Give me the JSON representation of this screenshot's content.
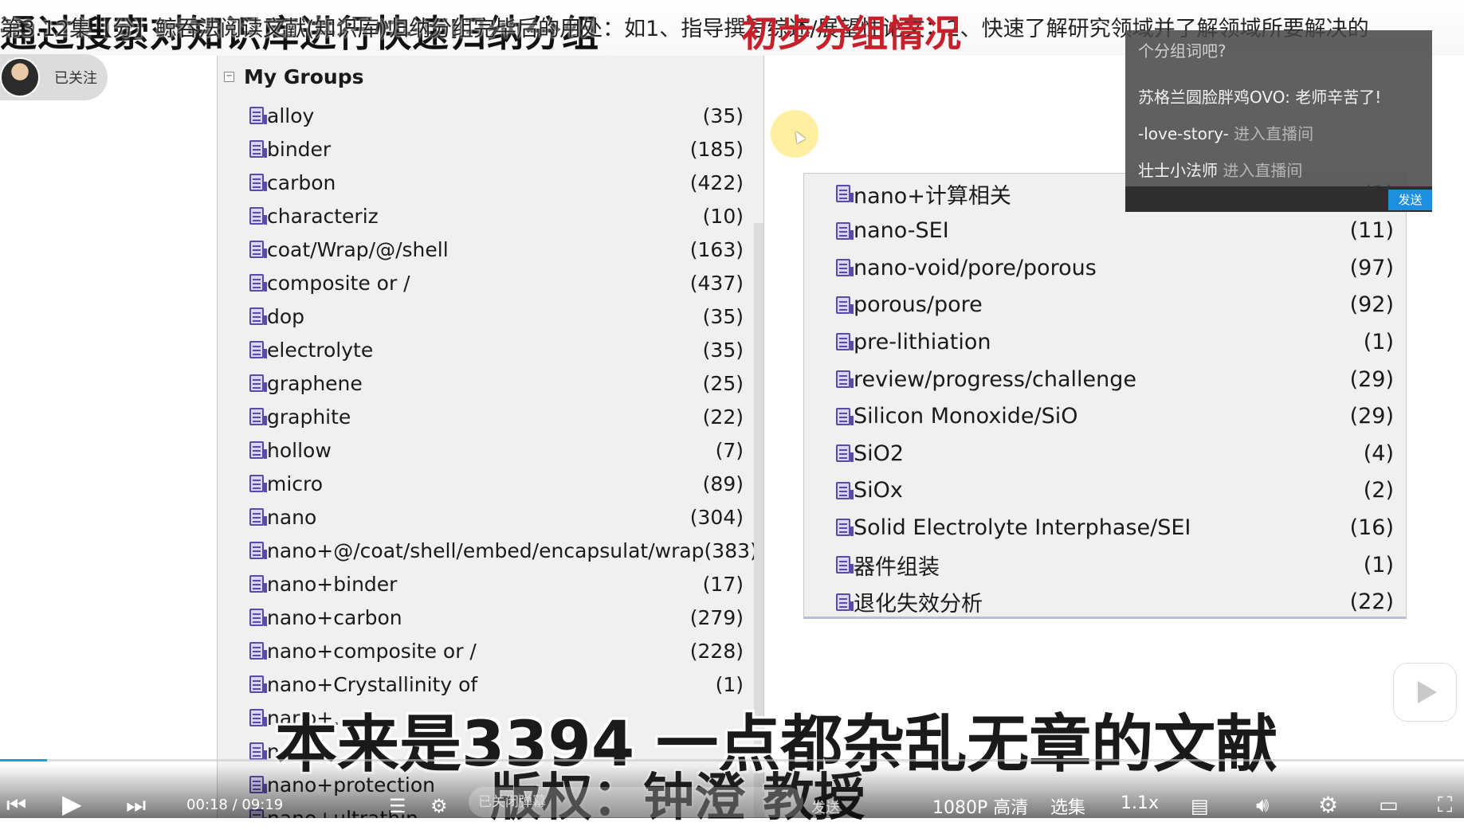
{
  "video": {
    "title_big": "通过搜索对知识库进行快速归纳分组",
    "title_line": "第3.12集【分】鲸吞法阅读文献(知识库)归纳分组完毕后的用处：如1、指导撰写综述/展望性论文；2、快速了解研究领域并了解领域所要解决的",
    "title_red": "初步分组情况",
    "follow_label": "已关注",
    "subtitle": "本来是3394 一点都杂乱无章的文献",
    "copyright": "版权：钟澄 教授"
  },
  "groups": {
    "title": "My Groups",
    "collapse_symbol": "⊟",
    "items": [
      {
        "name": "alloy",
        "count": "(35)"
      },
      {
        "name": "binder",
        "count": "(185)"
      },
      {
        "name": "carbon",
        "count": "(422)"
      },
      {
        "name": "characteriz",
        "count": "(10)"
      },
      {
        "name": "coat/Wrap/@/shell",
        "count": "(163)"
      },
      {
        "name": "composite or /",
        "count": "(437)"
      },
      {
        "name": "dop",
        "count": "(35)"
      },
      {
        "name": "electrolyte",
        "count": "(35)"
      },
      {
        "name": "graphene",
        "count": "(25)"
      },
      {
        "name": "graphite",
        "count": "(22)"
      },
      {
        "name": "hollow",
        "count": "(7)"
      },
      {
        "name": "micro",
        "count": "(89)"
      },
      {
        "name": "nano",
        "count": "(304)"
      },
      {
        "name": "nano+@/coat/shell/embed/encapsulat/wrap",
        "count": "(383)"
      },
      {
        "name": "nano+binder",
        "count": "(17)"
      },
      {
        "name": "nano+carbon",
        "count": "(279)"
      },
      {
        "name": "nano+composite or /",
        "count": "(228)"
      },
      {
        "name": "nano+Crystallinity of",
        "count": "(1)"
      },
      {
        "name": "nano+...",
        "count": ""
      },
      {
        "name": "n...",
        "count": ""
      },
      {
        "name": "nano+protection",
        "count": ""
      },
      {
        "name": "nano+ultrathin",
        "count": ""
      }
    ]
  },
  "subgroups": {
    "items": [
      {
        "name": "nano+计算相关",
        "count": "(1)"
      },
      {
        "name": "nano-SEI",
        "count": "(11)"
      },
      {
        "name": "nano-void/pore/porous",
        "count": "(97)"
      },
      {
        "name": "porous/pore",
        "count": "(92)"
      },
      {
        "name": "pre-lithiation",
        "count": "(1)"
      },
      {
        "name": "review/progress/challenge",
        "count": "(29)"
      },
      {
        "name": "Silicon Monoxide/SiO",
        "count": "(29)"
      },
      {
        "name": "SiO2",
        "count": "(4)"
      },
      {
        "name": "SiOx",
        "count": "(2)"
      },
      {
        "name": "Solid Electrolyte Interphase/SEI",
        "count": "(16)"
      },
      {
        "name": "器件组装",
        "count": "(1)"
      },
      {
        "name": "退化失效分析",
        "count": "(22)"
      }
    ]
  },
  "chat": {
    "line0": "个分组词吧?",
    "line1_user": "苏格兰圆脸胖鸡OVO:",
    "line1_msg": " 老师辛苦了!",
    "line2_user": "-love-story-",
    "line2_msg": " 进入直播间",
    "line3_user": "壮士小法师",
    "line3_msg": " 进入直播间",
    "send": "发送"
  },
  "player": {
    "time": "00:18 / 09:19",
    "danmu_placeholder": "已关闭弹幕",
    "danmu_send": "发送",
    "quality": "1080P 高清",
    "episodes": "选集",
    "speed": "1.1x",
    "progress": 0.032
  }
}
